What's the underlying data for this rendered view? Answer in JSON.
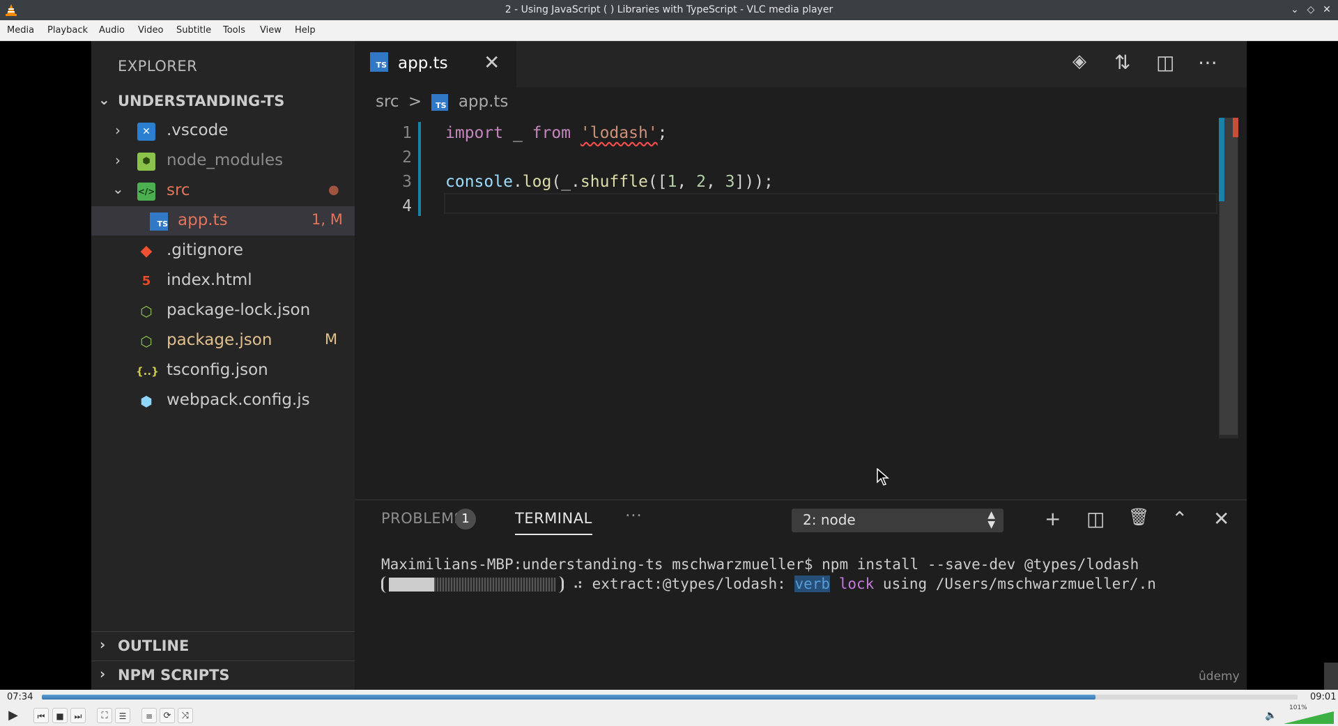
{
  "window": {
    "title": "2 - Using JavaScript ( ) Libraries with TypeScript - VLC media player",
    "controls": [
      "⌄",
      "◇",
      "✕"
    ]
  },
  "menu": [
    "Media",
    "Playback",
    "Audio",
    "Video",
    "Subtitle",
    "Tools",
    "View",
    "Help"
  ],
  "vscode": {
    "explorer_title": "EXPLORER",
    "project": "UNDERSTANDING-TS",
    "tree": [
      {
        "label": ".vscode",
        "decoration": "",
        "icon": "vscode-folder-icon"
      },
      {
        "label": "node_modules",
        "decoration": "",
        "icon": "node-folder-icon"
      },
      {
        "label": "src",
        "decoration": "●",
        "icon": "src-folder-icon"
      },
      {
        "label": "app.ts",
        "decoration": "1, M",
        "icon": "typescript-icon"
      },
      {
        "label": ".gitignore",
        "decoration": "",
        "icon": "git-icon"
      },
      {
        "label": "index.html",
        "decoration": "",
        "icon": "html5-icon"
      },
      {
        "label": "package-lock.json",
        "decoration": "",
        "icon": "nodejs-icon"
      },
      {
        "label": "package.json",
        "decoration": "M",
        "icon": "nodejs-icon"
      },
      {
        "label": "tsconfig.json",
        "decoration": "",
        "icon": "json-icon"
      },
      {
        "label": "webpack.config.js",
        "decoration": "",
        "icon": "webpack-icon"
      }
    ],
    "outline": "OUTLINE",
    "npm_scripts": "NPM SCRIPTS",
    "tab": {
      "label": "app.ts",
      "badge": "TS"
    },
    "breadcrumb": {
      "folder": "src",
      "separator": ">",
      "file": "app.ts"
    },
    "line_numbers": [
      "1",
      "2",
      "3",
      "4"
    ],
    "code": {
      "l1_kw1": "import",
      "l1_mid": " _ ",
      "l1_kw2": "from",
      "l1_str": "'lodash'",
      "l1_end": ";",
      "l3_obj": "console",
      "l3_dot": ".",
      "l3_fn": "log",
      "l3_open": "(_.",
      "l3_fn2": "shuffle",
      "l3_args_open": "([",
      "l3_n1": "1",
      "l3_sep1": ", ",
      "l3_n2": "2",
      "l3_sep2": ", ",
      "l3_n3": "3",
      "l3_close": "]));"
    },
    "panel": {
      "problems": "PROBLEMS",
      "problems_count": "1",
      "terminal": "TERMINAL",
      "more": "···",
      "terminal_select": "2: node",
      "terminal_line1": "Maximilians-MBP:understanding-ts mschwarzmueller$ npm install --save-dev @types/lodash",
      "terminal_line2_pre": " ⠴ extract:@types/lodash: ",
      "terminal_verb": "verb",
      "terminal_lock": "lock",
      "terminal_line2_post": " using /Users/mschwarzmueller/.n",
      "progress_fraction": 0.27
    },
    "watermark": "ûdemy"
  },
  "player": {
    "elapsed": "07:34",
    "total": "09:01",
    "progress_fraction": 0.839,
    "volume_text": "101%",
    "volume_fraction": 1.0
  }
}
